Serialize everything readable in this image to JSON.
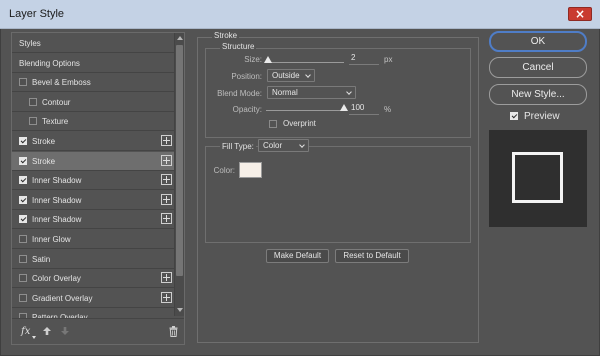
{
  "window": {
    "title": "Layer Style",
    "close_glyph": "×"
  },
  "styles_panel": {
    "items": [
      {
        "label": "Styles",
        "checkbox": null,
        "indent": 0,
        "add": false,
        "selected": false
      },
      {
        "label": "Blending Options",
        "checkbox": null,
        "indent": 0,
        "add": false,
        "selected": false
      },
      {
        "label": "Bevel & Emboss",
        "checkbox": false,
        "indent": 0,
        "add": false,
        "selected": false
      },
      {
        "label": "Contour",
        "checkbox": false,
        "indent": 1,
        "add": false,
        "selected": false
      },
      {
        "label": "Texture",
        "checkbox": false,
        "indent": 1,
        "add": false,
        "selected": false
      },
      {
        "label": "Stroke",
        "checkbox": true,
        "indent": 0,
        "add": true,
        "selected": false
      },
      {
        "label": "Stroke",
        "checkbox": true,
        "indent": 0,
        "add": true,
        "selected": true
      },
      {
        "label": "Inner Shadow",
        "checkbox": true,
        "indent": 0,
        "add": true,
        "selected": false
      },
      {
        "label": "Inner Shadow",
        "checkbox": true,
        "indent": 0,
        "add": true,
        "selected": false
      },
      {
        "label": "Inner Shadow",
        "checkbox": true,
        "indent": 0,
        "add": true,
        "selected": false
      },
      {
        "label": "Inner Glow",
        "checkbox": false,
        "indent": 0,
        "add": false,
        "selected": false
      },
      {
        "label": "Satin",
        "checkbox": false,
        "indent": 0,
        "add": false,
        "selected": false
      },
      {
        "label": "Color Overlay",
        "checkbox": false,
        "indent": 0,
        "add": true,
        "selected": false
      },
      {
        "label": "Gradient Overlay",
        "checkbox": false,
        "indent": 0,
        "add": true,
        "selected": false
      },
      {
        "label": "Pattern Overlay",
        "checkbox": false,
        "indent": 0,
        "add": false,
        "selected": false
      }
    ],
    "footer_icons": [
      "fx-icon",
      "move-up-icon",
      "move-down-icon",
      "trash-icon"
    ],
    "fx_label": "fx"
  },
  "stroke": {
    "group_label": "Stroke",
    "structure_label": "Structure",
    "size_label": "Size:",
    "size_value": "2",
    "size_unit": "px",
    "size_level": 0.02,
    "position_label": "Position:",
    "position_value": "Outside",
    "blend_mode_label": "Blend Mode:",
    "blend_mode_value": "Normal",
    "opacity_label": "Opacity:",
    "opacity_value": "100",
    "opacity_unit": "%",
    "opacity_level": 1.0,
    "overprint_label": "Overprint",
    "overprint_checked": false
  },
  "fill": {
    "fill_type_label": "Fill Type:",
    "fill_type_value": "Color",
    "color_label": "Color:",
    "color_value": "#f6efe7"
  },
  "buttons": {
    "make_default": "Make Default",
    "reset_default": "Reset to Default",
    "ok": "OK",
    "cancel": "Cancel",
    "new_style": "New Style...",
    "preview_label": "Preview",
    "preview_checked": true
  },
  "colors": {
    "accent": "#4f7dc7",
    "panel": "#535353",
    "titlebar": "#c4d2e5",
    "close": "#c93b30"
  }
}
